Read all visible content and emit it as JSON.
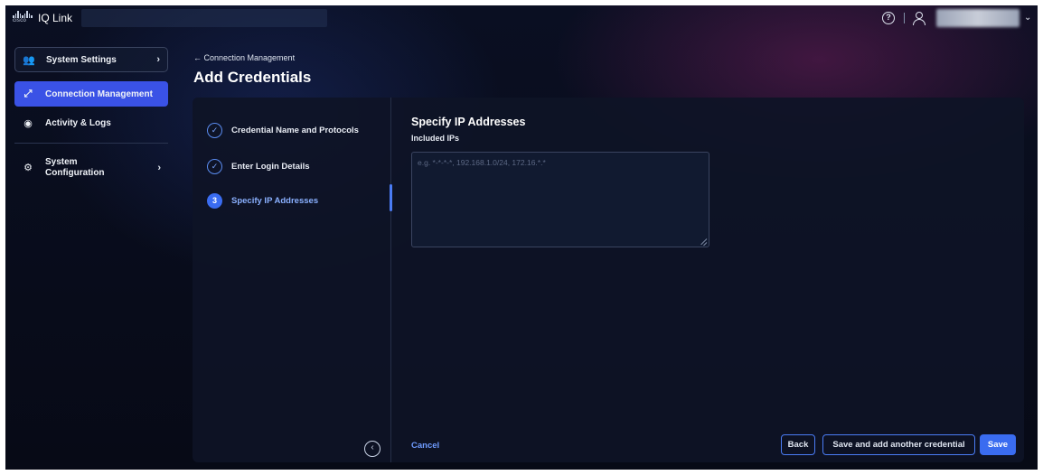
{
  "topbar": {
    "logo_text": "cisco",
    "app_name": "IQ Link",
    "help_icon": "help-circle-icon",
    "user_icon": "user-icon",
    "user_menu_chevron": "chevron-down-icon"
  },
  "sidebar": {
    "items": [
      {
        "label": "System Settings",
        "icon": "users-gear-icon",
        "chevron": "›"
      },
      {
        "label": "Connection Management",
        "icon": "connection-icon",
        "active": true
      },
      {
        "label": "Activity & Logs",
        "icon": "activity-icon"
      },
      {
        "label_line1": "System",
        "label_line2": "Configuration",
        "icon": "gear-icon",
        "chevron": "›"
      }
    ]
  },
  "header": {
    "breadcrumb": "← Connection Management",
    "title": "Add Credentials"
  },
  "steps": [
    {
      "number": "✓",
      "label": "Credential Name and Protocols",
      "state": "completed"
    },
    {
      "number": "✓",
      "label": "Enter Login Details",
      "state": "completed"
    },
    {
      "number": "3",
      "label": "Specify IP Addresses",
      "state": "active"
    }
  ],
  "form": {
    "section_title": "Specify IP Addresses",
    "included_ips_label": "Included IPs",
    "included_ips_placeholder": "e.g. *-*-*-*, 192.168.1.0/24, 172.16.*.*",
    "included_ips_value": ""
  },
  "actions": {
    "collapse_icon": "‹",
    "cancel": "Cancel",
    "back": "Back",
    "save_and_add": "Save and add another credential",
    "save": "Save"
  },
  "colors": {
    "accent": "#3a6cf0",
    "nav_active": "#3a52e6",
    "link": "#6f9cff",
    "background": "#070a16",
    "panel": "#0e1426"
  }
}
